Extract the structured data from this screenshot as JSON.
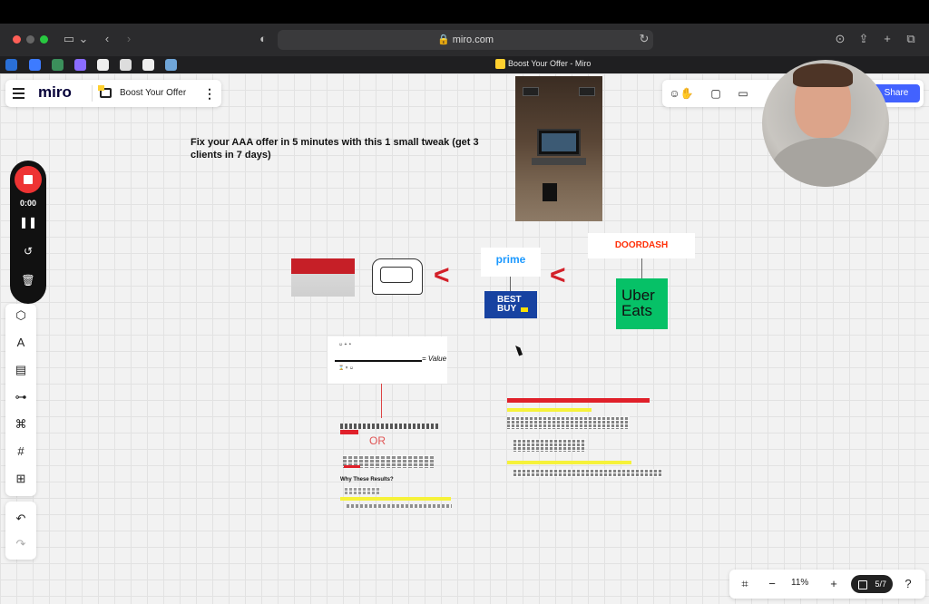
{
  "browser": {
    "url": "miro.com",
    "tab_title": "Boost Your Offer - Miro"
  },
  "miro": {
    "logo": "miro",
    "board_name": "Boost Your Offer",
    "share_label": "Share"
  },
  "recorder": {
    "time": "0:00"
  },
  "zoom": {
    "level": "11%",
    "pages": "5/7"
  },
  "board": {
    "title": "Fix your AAA offer in 5 minutes with this 1 small tweak (get 3 clients in 7 days)",
    "or_text": "OR",
    "why_heading": "Why These Results?",
    "prime": "prime",
    "bestbuy": "BEST BUY",
    "doordash": "DOORDASH",
    "ubereats": "Uber Eats",
    "value_label": "= Value"
  },
  "colors": {
    "miro_yellow": "#ffd02f",
    "share_blue": "#4262ff",
    "record_red": "#e33333"
  }
}
